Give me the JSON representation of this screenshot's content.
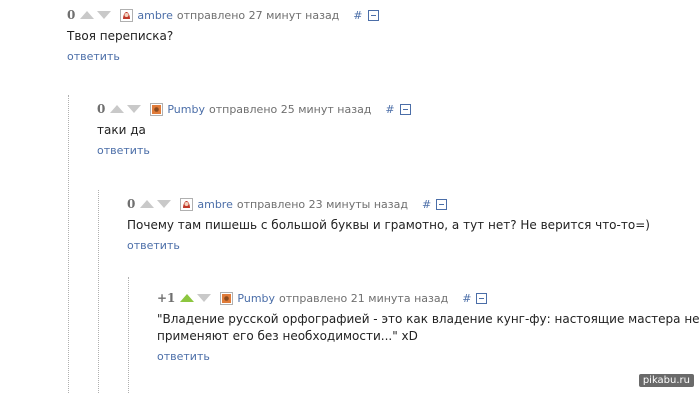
{
  "comments": [
    {
      "score": "0",
      "author": "ambre",
      "time": "отправлено 27 минут назад",
      "hash": "#",
      "text": "Твоя переписка?",
      "reply": "ответить"
    },
    {
      "score": "0",
      "author": "Pumby",
      "time": "отправлено 25 минут назад",
      "hash": "#",
      "text": "таки да",
      "reply": "ответить"
    },
    {
      "score": "0",
      "author": "ambre",
      "time": "отправлено 23 минуты назад",
      "hash": "#",
      "text": "Почему там пишешь с большой буквы и грамотно, а тут нет? Не верится что-то=)",
      "reply": "ответить"
    },
    {
      "score": "+1",
      "author": "Pumby",
      "time": "отправлено 21 минута назад",
      "hash": "#",
      "text_line1": "\"Владение русской орфографией - это как владение кунг-фу: настоящие мастера не",
      "text_line2": "применяют его без необходимости...\" xD",
      "reply": "ответить"
    }
  ],
  "watermark": "pikabu.ru",
  "colors": {
    "link": "#4b6ea8",
    "upvote_active": "#8cc63f",
    "arrow_inactive": "#c9c9c9"
  }
}
